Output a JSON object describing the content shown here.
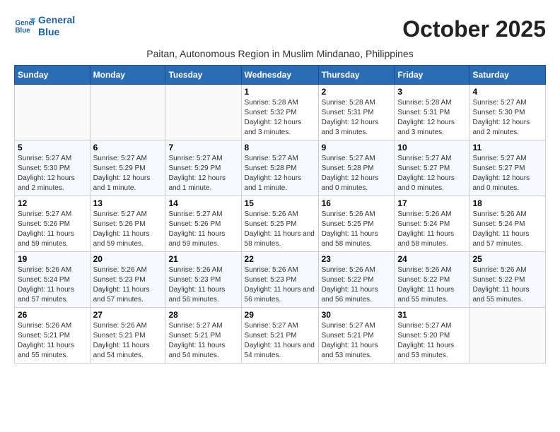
{
  "header": {
    "logo_line1": "General",
    "logo_line2": "Blue",
    "month_title": "October 2025",
    "subtitle": "Paitan, Autonomous Region in Muslim Mindanao, Philippines"
  },
  "weekdays": [
    "Sunday",
    "Monday",
    "Tuesday",
    "Wednesday",
    "Thursday",
    "Friday",
    "Saturday"
  ],
  "weeks": [
    [
      {
        "day": "",
        "sunrise": "",
        "sunset": "",
        "daylight": ""
      },
      {
        "day": "",
        "sunrise": "",
        "sunset": "",
        "daylight": ""
      },
      {
        "day": "",
        "sunrise": "",
        "sunset": "",
        "daylight": ""
      },
      {
        "day": "1",
        "sunrise": "Sunrise: 5:28 AM",
        "sunset": "Sunset: 5:32 PM",
        "daylight": "Daylight: 12 hours and 3 minutes."
      },
      {
        "day": "2",
        "sunrise": "Sunrise: 5:28 AM",
        "sunset": "Sunset: 5:31 PM",
        "daylight": "Daylight: 12 hours and 3 minutes."
      },
      {
        "day": "3",
        "sunrise": "Sunrise: 5:28 AM",
        "sunset": "Sunset: 5:31 PM",
        "daylight": "Daylight: 12 hours and 3 minutes."
      },
      {
        "day": "4",
        "sunrise": "Sunrise: 5:27 AM",
        "sunset": "Sunset: 5:30 PM",
        "daylight": "Daylight: 12 hours and 2 minutes."
      }
    ],
    [
      {
        "day": "5",
        "sunrise": "Sunrise: 5:27 AM",
        "sunset": "Sunset: 5:30 PM",
        "daylight": "Daylight: 12 hours and 2 minutes."
      },
      {
        "day": "6",
        "sunrise": "Sunrise: 5:27 AM",
        "sunset": "Sunset: 5:29 PM",
        "daylight": "Daylight: 12 hours and 1 minute."
      },
      {
        "day": "7",
        "sunrise": "Sunrise: 5:27 AM",
        "sunset": "Sunset: 5:29 PM",
        "daylight": "Daylight: 12 hours and 1 minute."
      },
      {
        "day": "8",
        "sunrise": "Sunrise: 5:27 AM",
        "sunset": "Sunset: 5:28 PM",
        "daylight": "Daylight: 12 hours and 1 minute."
      },
      {
        "day": "9",
        "sunrise": "Sunrise: 5:27 AM",
        "sunset": "Sunset: 5:28 PM",
        "daylight": "Daylight: 12 hours and 0 minutes."
      },
      {
        "day": "10",
        "sunrise": "Sunrise: 5:27 AM",
        "sunset": "Sunset: 5:27 PM",
        "daylight": "Daylight: 12 hours and 0 minutes."
      },
      {
        "day": "11",
        "sunrise": "Sunrise: 5:27 AM",
        "sunset": "Sunset: 5:27 PM",
        "daylight": "Daylight: 12 hours and 0 minutes."
      }
    ],
    [
      {
        "day": "12",
        "sunrise": "Sunrise: 5:27 AM",
        "sunset": "Sunset: 5:26 PM",
        "daylight": "Daylight: 11 hours and 59 minutes."
      },
      {
        "day": "13",
        "sunrise": "Sunrise: 5:27 AM",
        "sunset": "Sunset: 5:26 PM",
        "daylight": "Daylight: 11 hours and 59 minutes."
      },
      {
        "day": "14",
        "sunrise": "Sunrise: 5:27 AM",
        "sunset": "Sunset: 5:26 PM",
        "daylight": "Daylight: 11 hours and 59 minutes."
      },
      {
        "day": "15",
        "sunrise": "Sunrise: 5:26 AM",
        "sunset": "Sunset: 5:25 PM",
        "daylight": "Daylight: 11 hours and 58 minutes."
      },
      {
        "day": "16",
        "sunrise": "Sunrise: 5:26 AM",
        "sunset": "Sunset: 5:25 PM",
        "daylight": "Daylight: 11 hours and 58 minutes."
      },
      {
        "day": "17",
        "sunrise": "Sunrise: 5:26 AM",
        "sunset": "Sunset: 5:24 PM",
        "daylight": "Daylight: 11 hours and 58 minutes."
      },
      {
        "day": "18",
        "sunrise": "Sunrise: 5:26 AM",
        "sunset": "Sunset: 5:24 PM",
        "daylight": "Daylight: 11 hours and 57 minutes."
      }
    ],
    [
      {
        "day": "19",
        "sunrise": "Sunrise: 5:26 AM",
        "sunset": "Sunset: 5:24 PM",
        "daylight": "Daylight: 11 hours and 57 minutes."
      },
      {
        "day": "20",
        "sunrise": "Sunrise: 5:26 AM",
        "sunset": "Sunset: 5:23 PM",
        "daylight": "Daylight: 11 hours and 57 minutes."
      },
      {
        "day": "21",
        "sunrise": "Sunrise: 5:26 AM",
        "sunset": "Sunset: 5:23 PM",
        "daylight": "Daylight: 11 hours and 56 minutes."
      },
      {
        "day": "22",
        "sunrise": "Sunrise: 5:26 AM",
        "sunset": "Sunset: 5:23 PM",
        "daylight": "Daylight: 11 hours and 56 minutes."
      },
      {
        "day": "23",
        "sunrise": "Sunrise: 5:26 AM",
        "sunset": "Sunset: 5:22 PM",
        "daylight": "Daylight: 11 hours and 56 minutes."
      },
      {
        "day": "24",
        "sunrise": "Sunrise: 5:26 AM",
        "sunset": "Sunset: 5:22 PM",
        "daylight": "Daylight: 11 hours and 55 minutes."
      },
      {
        "day": "25",
        "sunrise": "Sunrise: 5:26 AM",
        "sunset": "Sunset: 5:22 PM",
        "daylight": "Daylight: 11 hours and 55 minutes."
      }
    ],
    [
      {
        "day": "26",
        "sunrise": "Sunrise: 5:26 AM",
        "sunset": "Sunset: 5:21 PM",
        "daylight": "Daylight: 11 hours and 55 minutes."
      },
      {
        "day": "27",
        "sunrise": "Sunrise: 5:26 AM",
        "sunset": "Sunset: 5:21 PM",
        "daylight": "Daylight: 11 hours and 54 minutes."
      },
      {
        "day": "28",
        "sunrise": "Sunrise: 5:27 AM",
        "sunset": "Sunset: 5:21 PM",
        "daylight": "Daylight: 11 hours and 54 minutes."
      },
      {
        "day": "29",
        "sunrise": "Sunrise: 5:27 AM",
        "sunset": "Sunset: 5:21 PM",
        "daylight": "Daylight: 11 hours and 54 minutes."
      },
      {
        "day": "30",
        "sunrise": "Sunrise: 5:27 AM",
        "sunset": "Sunset: 5:21 PM",
        "daylight": "Daylight: 11 hours and 53 minutes."
      },
      {
        "day": "31",
        "sunrise": "Sunrise: 5:27 AM",
        "sunset": "Sunset: 5:20 PM",
        "daylight": "Daylight: 11 hours and 53 minutes."
      },
      {
        "day": "",
        "sunrise": "",
        "sunset": "",
        "daylight": ""
      }
    ]
  ]
}
